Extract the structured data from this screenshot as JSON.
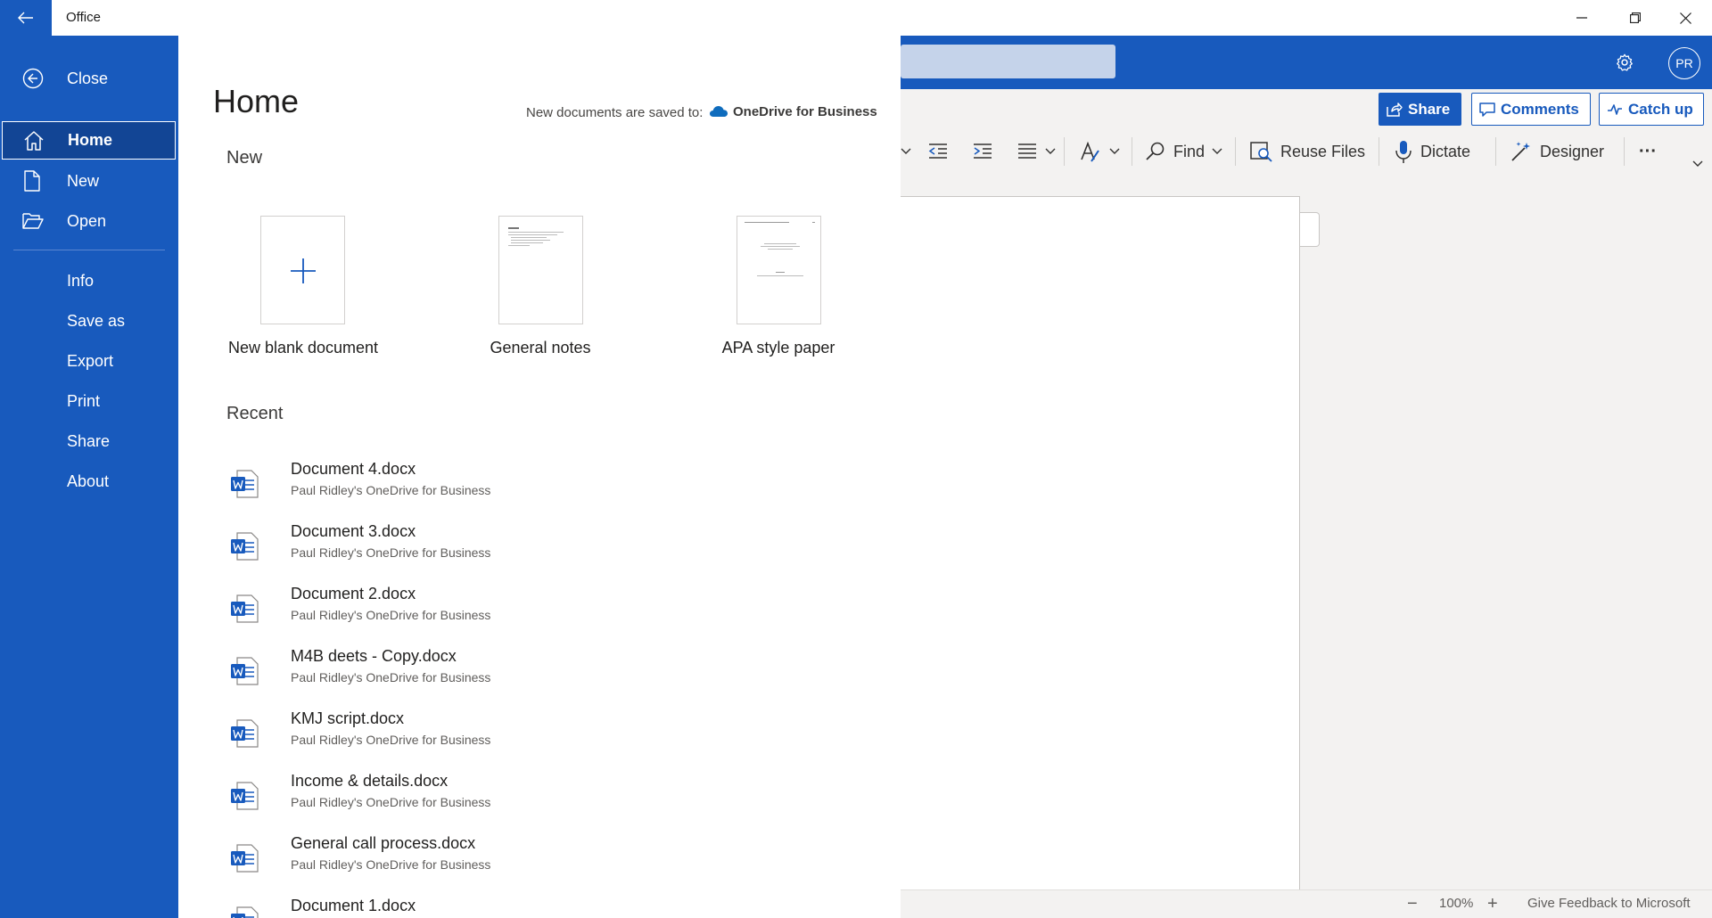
{
  "titlebar": {
    "app_title": "Office"
  },
  "sidebar": {
    "close_label": "Close",
    "items": [
      {
        "label": "Home",
        "icon": "home-icon",
        "selected": true
      },
      {
        "label": "New",
        "icon": "new-document-icon"
      },
      {
        "label": "Open",
        "icon": "folder-open-icon"
      },
      {
        "label": "Info"
      },
      {
        "label": "Save as"
      },
      {
        "label": "Export"
      },
      {
        "label": "Print"
      },
      {
        "label": "Share"
      },
      {
        "label": "About"
      }
    ]
  },
  "main": {
    "title": "Home",
    "save_note": "New documents are saved to:",
    "save_location": "OneDrive for Business",
    "new_heading": "New",
    "templates": [
      {
        "label": "New blank document"
      },
      {
        "label": "General notes"
      },
      {
        "label": "APA style paper"
      }
    ],
    "recent_heading": "Recent",
    "recent": [
      {
        "name": "Document 4.docx",
        "location": "Paul Ridley's OneDrive for Business"
      },
      {
        "name": "Document 3.docx",
        "location": "Paul Ridley's OneDrive for Business"
      },
      {
        "name": "Document 2.docx",
        "location": "Paul Ridley's OneDrive for Business"
      },
      {
        "name": "M4B deets - Copy.docx",
        "location": "Paul Ridley's OneDrive for Business"
      },
      {
        "name": "KMJ script.docx",
        "location": "Paul Ridley's OneDrive for Business"
      },
      {
        "name": "Income & details.docx",
        "location": "Paul Ridley's OneDrive for Business"
      },
      {
        "name": "General call process.docx",
        "location": "Paul Ridley's OneDrive for Business"
      },
      {
        "name": "Document 1.docx",
        "location": ""
      }
    ]
  },
  "word": {
    "avatar_initials": "PR",
    "share_label": "Share",
    "comments_label": "Comments",
    "catchup_label": "Catch up",
    "ribbon": {
      "find_label": "Find",
      "reuse_files_label": "Reuse Files",
      "dictate_label": "Dictate",
      "designer_label": "Designer",
      "more_label": "···"
    },
    "status": {
      "zoom_out": "−",
      "zoom_level": "100%",
      "zoom_in": "+",
      "feedback": "Give Feedback to Microsoft"
    }
  },
  "colors": {
    "brand": "#185abd",
    "selected_nav": "#124595",
    "ribbon_bg": "#f3f2f1"
  }
}
